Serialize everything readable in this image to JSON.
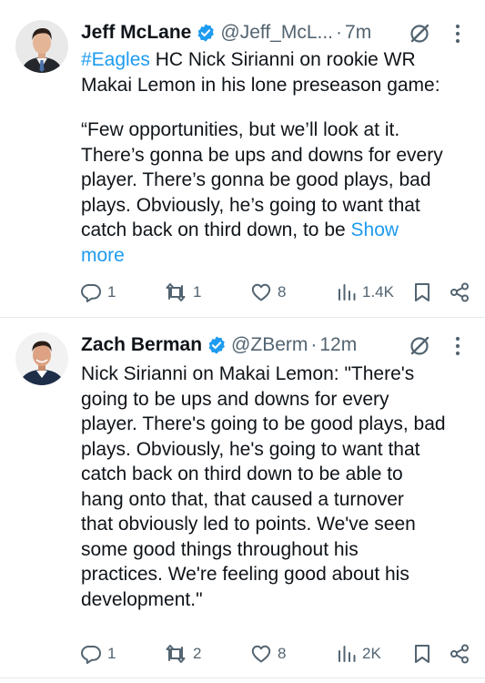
{
  "tweets": [
    {
      "author": "Jeff McLane",
      "handle": "@Jeff_McL...",
      "separator": "·",
      "time": "7m",
      "body": {
        "hashtag": "#Eagles",
        "line1_rest": " HC Nick Sirianni on",
        "line2": "rookie WR",
        "line3": "Makai Lemon in his lone preseason game:",
        "quote_lines": [
          "“Few opportunities, but we’ll look at it.",
          "There’s gonna be ups and downs for every",
          "player. There’s gonna be good plays, bad",
          "plays. Obviously, he’s going to want that"
        ],
        "last_line": "catch back on third down, to be ",
        "show_more_1": "Show",
        "show_more_2": "more"
      },
      "stats": {
        "replies": "1",
        "reposts": "1",
        "likes": "8",
        "views": "1.4K"
      }
    },
    {
      "author": "Zach Berman",
      "handle": "@ZBerm",
      "separator": "·",
      "time": "12m",
      "body_lines": [
        "Nick Sirianni on Makai Lemon: \"There's",
        "going to be ups and downs for every",
        "player. There's going to be good plays, bad",
        "plays. Obviously, he's going to want that",
        "catch back on third down to be able to",
        "hang onto that, that caused a turnover",
        "that obviously led to points. We've seen",
        "some good things throughout his",
        "practices. We're feeling good about his",
        "development.\""
      ],
      "stats": {
        "replies": "1",
        "reposts": "2",
        "likes": "8",
        "views": "2K"
      }
    }
  ],
  "icons": {
    "verified": "verified-badge-icon",
    "grok": "grok-icon",
    "more": "more-dots-icon",
    "reply": "reply-icon",
    "repost": "repost-icon",
    "like": "heart-icon",
    "views": "views-chart-icon",
    "bookmark": "bookmark-icon",
    "share": "share-icon"
  },
  "colors": {
    "text": "#0f1419",
    "secondary": "#536471",
    "link": "#1d9bf0",
    "verified": "#1d9bf0",
    "divider": "#e6e9eb"
  }
}
